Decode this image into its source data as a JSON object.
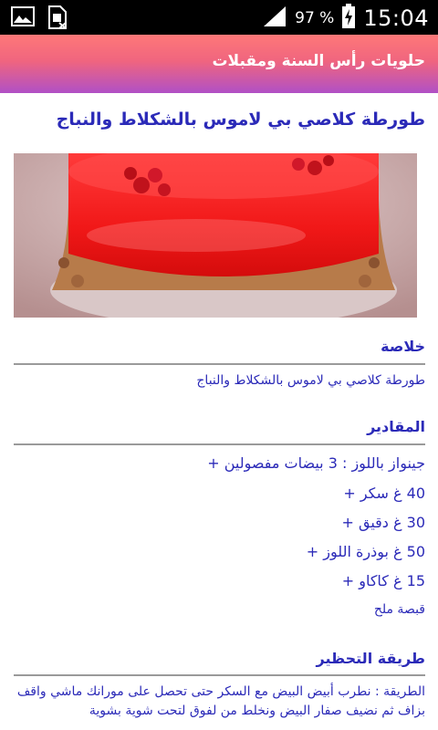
{
  "status_bar": {
    "battery_percent": "97 %",
    "time": "15:04",
    "left_icons": [
      "image-icon",
      "sim-card-icon"
    ],
    "right_icons": [
      "signal-icon",
      "battery-charging-icon"
    ]
  },
  "app_bar": {
    "title": "حلويات رأس السنة ومقبلات",
    "gradient": [
      "#fe7878",
      "#b050c6"
    ]
  },
  "article": {
    "title": "طورطة كلاصي بي لاموس بالشكلاط والنباج",
    "summary_heading": "خلاصة",
    "summary_text": "طورطة كلاصي بي لاموس بالشكلاط والنباج",
    "ingredients_heading": "المقادير",
    "ingredients": [
      "جينواز باللوز : 3 بيضات مفصولين +",
      "40 غ سكر +",
      "30 غ دقيق +",
      "50 غ بوذرة اللوز +",
      "15 غ كاكاو +",
      "قبصة ملح"
    ],
    "preparation_heading": "طريقة التحظير",
    "preparation_text": "الطريقة : نطرب أبيض البيض مع السكر حتى تحصل على مورانك ماشي واقف بزاف ثم نضيف صفار البيض ونخلط من لفوق لتحت شوية بشوية"
  },
  "colors": {
    "accent_text": "#2b2ab8",
    "divider": "#9a9a9a"
  }
}
